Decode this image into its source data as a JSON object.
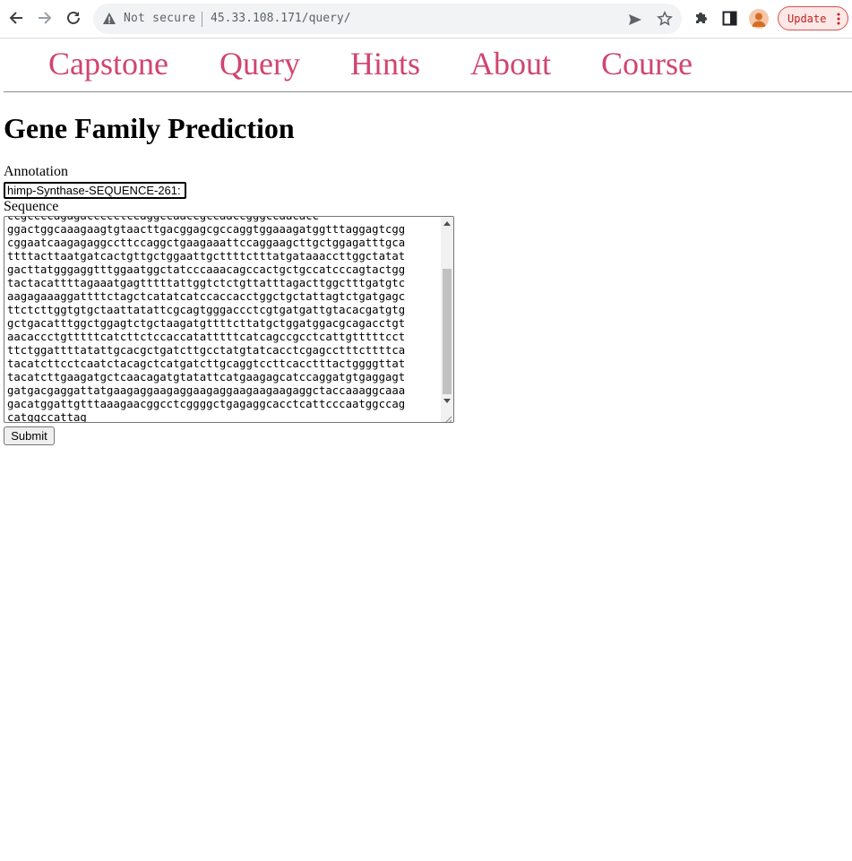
{
  "browser": {
    "security_label": "Not secure",
    "url": "45.33.108.171/query/",
    "update_label": "Update"
  },
  "nav": {
    "items": [
      "Capstone",
      "Query",
      "Hints",
      "About",
      "Course"
    ]
  },
  "page": {
    "title": "Gene Family Prediction"
  },
  "form": {
    "annotation_label": "Annotation",
    "annotation_value": ":himp-Synthase-SEQUENCE-261",
    "sequence_label": "Sequence",
    "sequence_lines": [
      "ccgccccagagaccccctccaggccaaccgccaaccgggccaacacc",
      "ggactggcaaagaagtgtaacttgacggagcgccaggtggaaagatggtttaggagtcgg",
      "cggaatcaagagaggccttccaggctgaagaaattccaggaagcttgctggagatttgca",
      "ttttacttaatgatcactgttgctggaattgcttttctttatgataaaccttggctatat",
      "gacttatgggaggtttggaatggctatcccaaacagccactgctgccatcccagtactgg",
      "tactacattttagaaatgagtttttattggtctctgttatttagacttggctttgatgtc",
      "aagagaaaggattttctagctcatatcatccaccacctggctgctattagtctgatgagc",
      "ttctcttggtgtgctaattatattcgcagtgggaccctcgtgatgattgtacacgatgtg",
      "gctgacatttggctggagtctgctaagatgttttcttatgctggatggacgcagacctgt",
      "aacaccctgtttttcatcttctccaccatatttttcatcagccgcctcattgtttttcct",
      "ttctggattttatattgcacgctgatcttgcctatgtatcacctcgagcctttcttttca",
      "tacatcttcctcaatctacagctcatgatcttgcaggtccttcacctttactggggttat",
      "tacatcttgaagatgctcaacagatgtatattcatgaagagcatccaggatgtgaggagt",
      "gatgacgaggattatgaagaggaagaggaagaggaagaagaagaggctaccaaaggcaaa",
      "gacatggattgtttaaagaacggcctcggggctgagaggcacctcattcccaatggccag",
      "catggccattag"
    ],
    "submit_label": "Submit"
  }
}
